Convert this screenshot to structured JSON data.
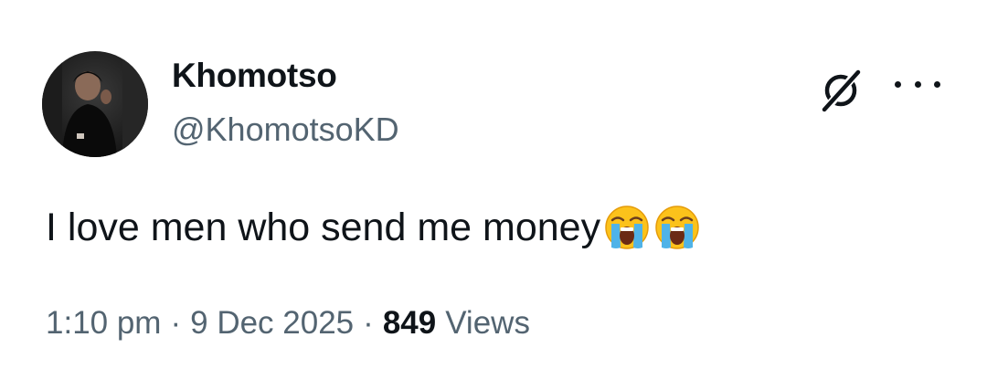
{
  "author": {
    "display_name": "Khomotso",
    "handle": "@KhomotsoKD",
    "avatar_icon": "user-avatar-photo"
  },
  "header_actions": {
    "grok_icon": "grok-icon",
    "more_icon": "more-options-icon"
  },
  "tweet": {
    "text": "I love men who send me money",
    "emojis": [
      "loudly-crying-face",
      "loudly-crying-face"
    ]
  },
  "meta": {
    "time": "1:10 pm",
    "separator": "·",
    "date": "9 Dec 2025",
    "views_count": "849",
    "views_label": "Views"
  },
  "colors": {
    "primary_text": "#0f1419",
    "secondary_text": "#536471",
    "background": "#ffffff"
  }
}
